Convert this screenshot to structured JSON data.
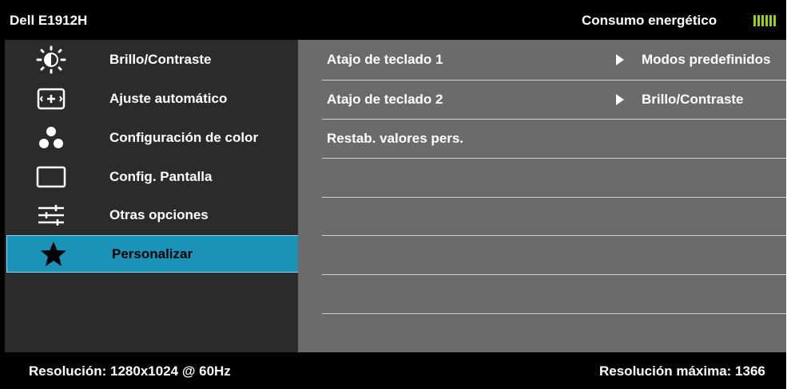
{
  "header": {
    "title": "Dell E1912H",
    "energy_label": "Consumo energético",
    "energy_level": 1.0,
    "energy_color": "#9bd400"
  },
  "sidebar": {
    "items": [
      {
        "label": "Brillo/Contraste",
        "icon": "brightness-icon"
      },
      {
        "label": "Ajuste  automático",
        "icon": "auto-adjust-icon"
      },
      {
        "label": "Configuración de color",
        "icon": "color-settings-icon"
      },
      {
        "label": "Config. Pantalla",
        "icon": "display-settings-icon"
      },
      {
        "label": "Otras opciones",
        "icon": "other-settings-icon"
      },
      {
        "label": "Personalizar",
        "icon": "star-icon",
        "selected": true
      }
    ]
  },
  "panel": {
    "rows": [
      {
        "label": "Atajo de teclado 1",
        "value": "Modos predefinidos"
      },
      {
        "label": "Atajo de teclado 2",
        "value": "Brillo/Contraste"
      },
      {
        "label": "Restab. valores pers.",
        "value": ""
      }
    ]
  },
  "footer": {
    "resolution": "Resolución: 1280x1024 @ 60Hz",
    "max_resolution": "Resolución máxima: 1366"
  },
  "colors": {
    "selected_bg": "#1b93b8",
    "sidebar_bg": "#2b2b2b",
    "panel_bg": "#6b6b6b"
  }
}
